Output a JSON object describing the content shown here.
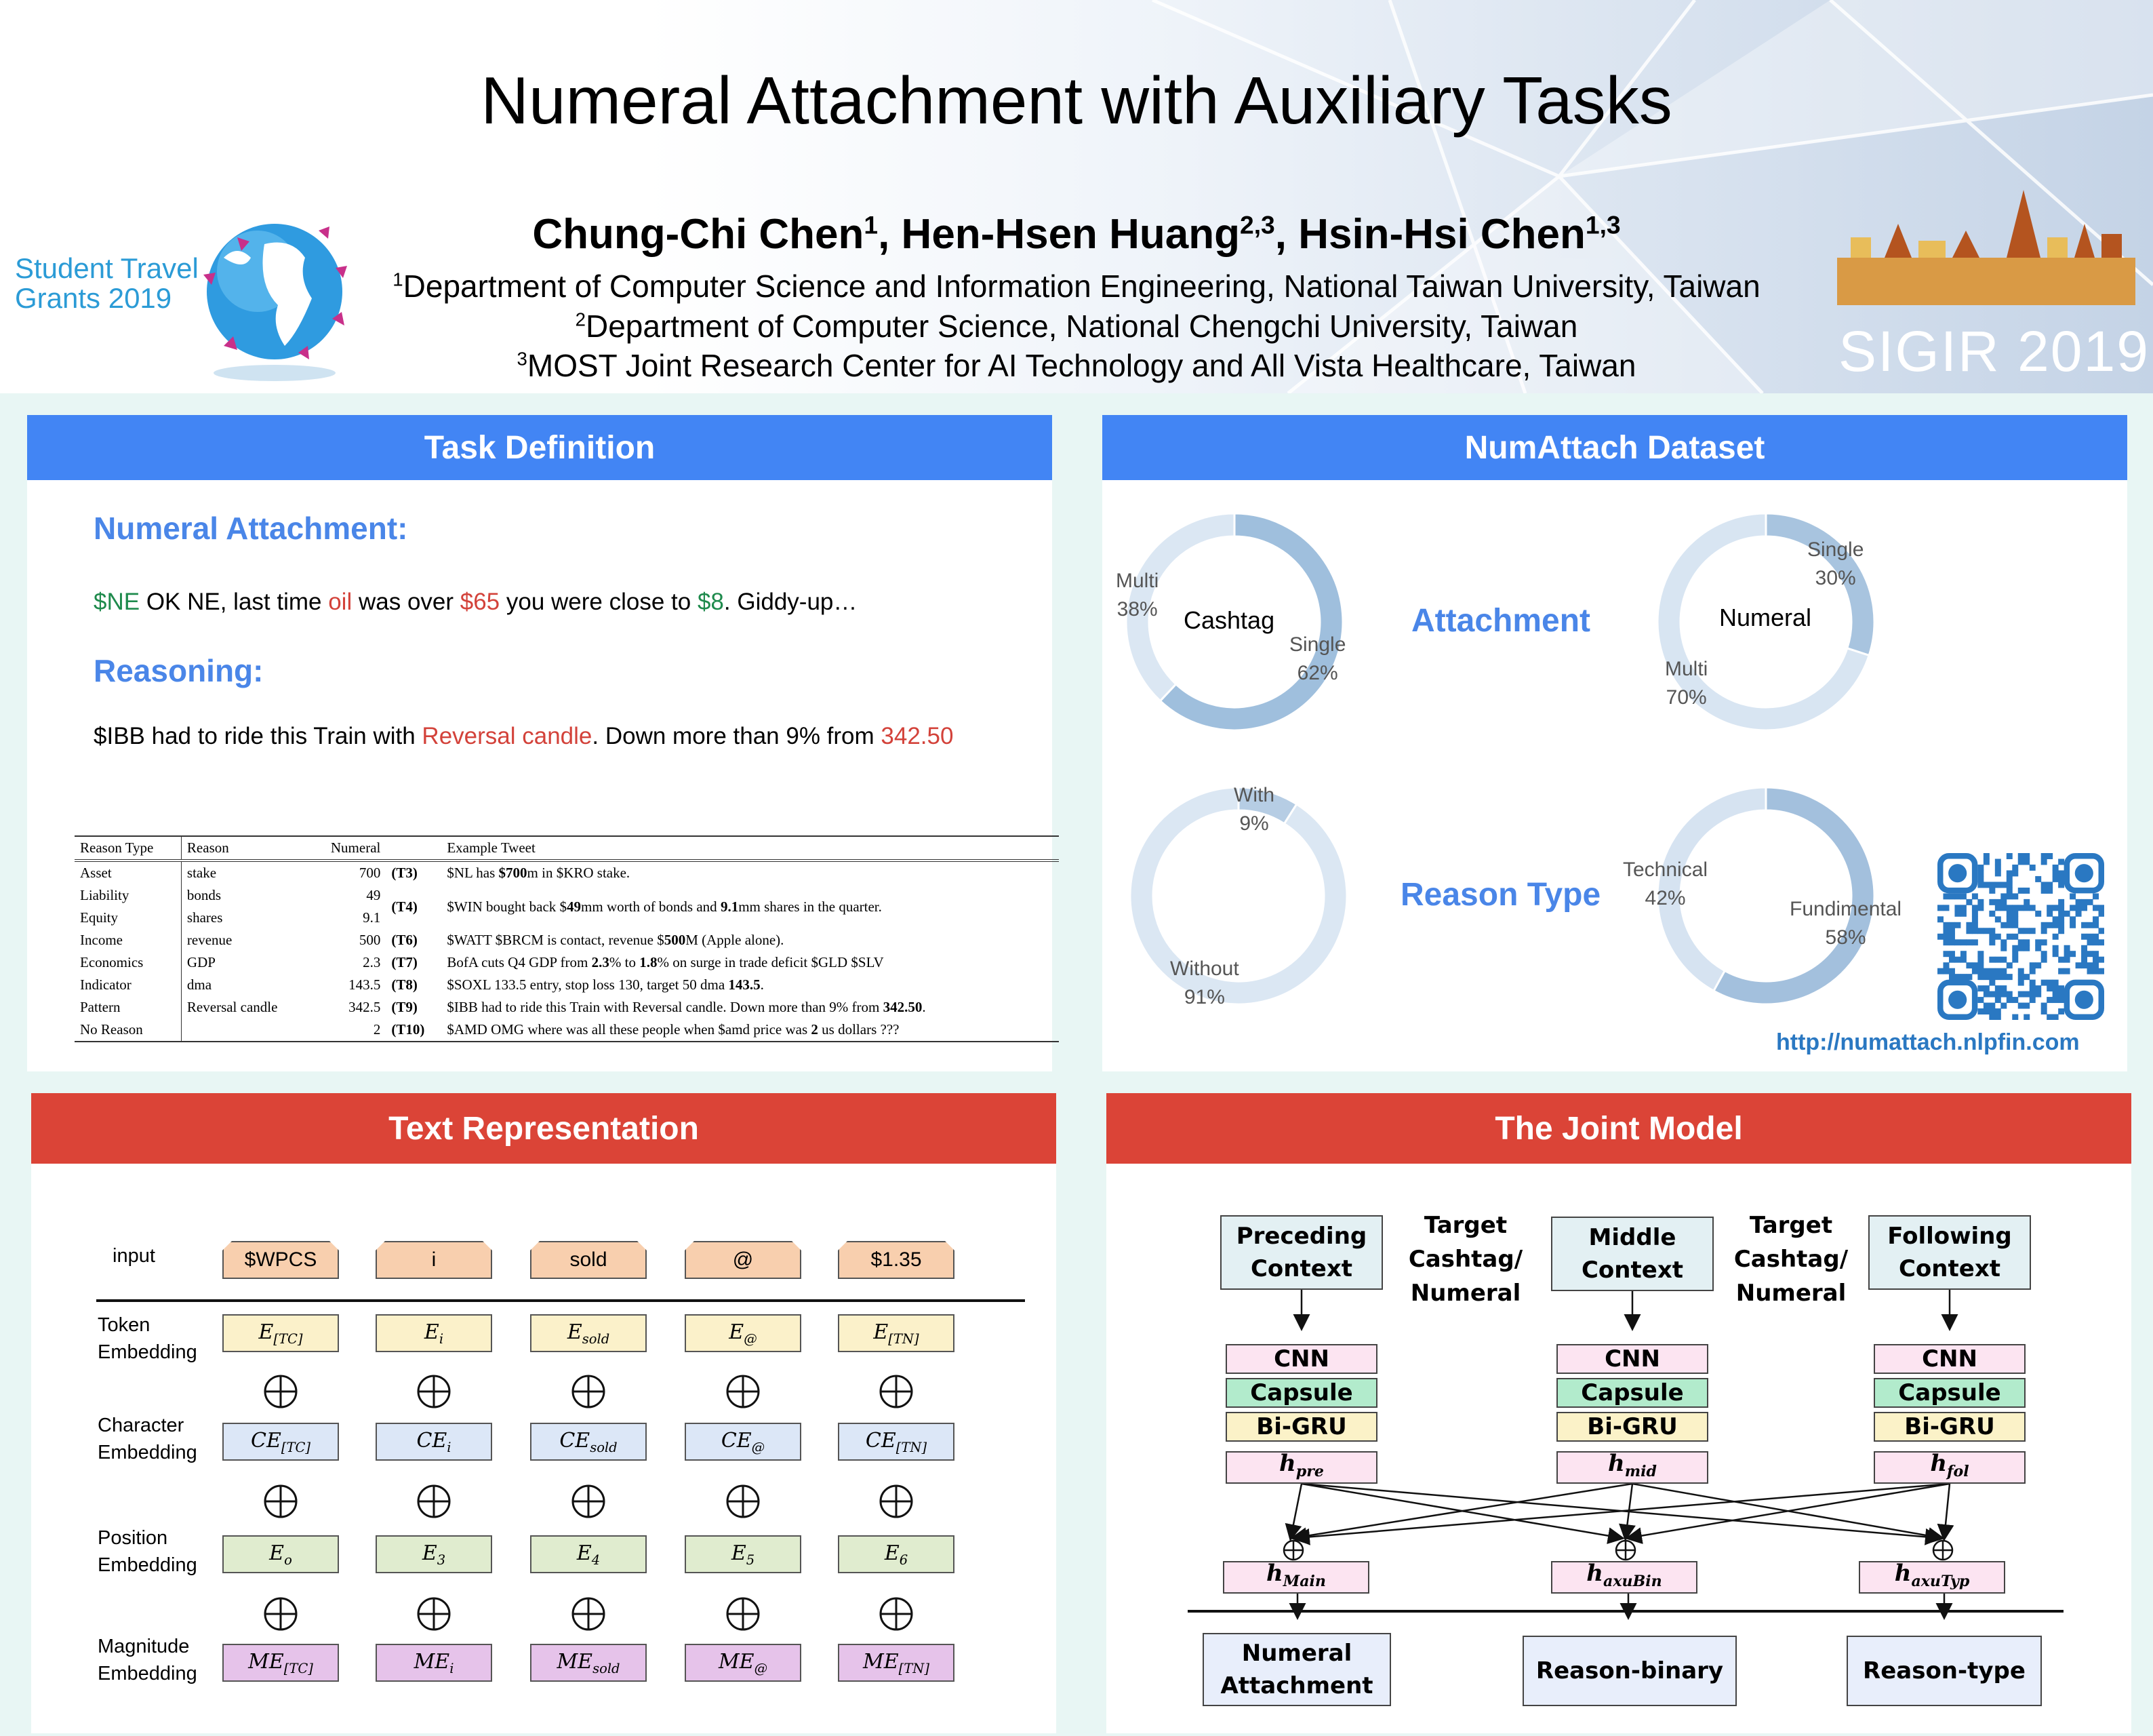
{
  "header": {
    "title": "Numeral Attachment with Auxiliary Tasks",
    "authors": [
      {
        "name": "Chung-Chi Chen",
        "sup": "1"
      },
      {
        "name": "Hen-Hsen Huang",
        "sup": "2,3"
      },
      {
        "name": "Hsin-Hsi Chen",
        "sup": "1,3"
      }
    ],
    "affiliations": [
      {
        "sup": "1",
        "text": "Department of Computer Science and Information Engineering, National Taiwan University, Taiwan"
      },
      {
        "sup": "2",
        "text": "Department of Computer Science, National Chengchi University, Taiwan"
      },
      {
        "sup": "3",
        "text": "MOST Joint Research Center for AI Technology and All Vista Healthcare, Taiwan"
      }
    ],
    "logo_left": [
      "Student Travel",
      "Grants 2019"
    ],
    "logo_right": "SIGIR 2019"
  },
  "task_definition": {
    "heading": "Task Definition",
    "numeral_attachment_title": "Numeral Attachment:",
    "example1": [
      {
        "t": "$NE",
        "c": "green"
      },
      {
        "t": " OK NE, last time ",
        "c": "black"
      },
      {
        "t": "oil",
        "c": "red"
      },
      {
        "t": " was over ",
        "c": "black"
      },
      {
        "t": "$65",
        "c": "red"
      },
      {
        "t": " you were close to ",
        "c": "black"
      },
      {
        "t": "$8",
        "c": "green"
      },
      {
        "t": ". Giddy-up…",
        "c": "black"
      }
    ],
    "reasoning_title": "Reasoning:",
    "example2": [
      {
        "t": "$IBB had to ride this Train with ",
        "c": "black"
      },
      {
        "t": "Reversal candle",
        "c": "red"
      },
      {
        "t": ". Down more than 9% from ",
        "c": "black"
      },
      {
        "t": "342.50",
        "c": "red"
      }
    ],
    "table": {
      "headers": [
        "Reason Type",
        "Reason",
        "Numeral",
        "",
        "Example Tweet"
      ],
      "rows": [
        [
          "Asset",
          "stake",
          "700",
          "(T3)",
          "$NL has <b>$700</b>m in $KRO stake."
        ],
        [
          "Liability",
          "bonds",
          "49",
          "",
          ""
        ],
        [
          "Equity",
          "shares",
          "9.1",
          "(T4)",
          "$WIN bought back $<b>49</b>mm worth of bonds and <b>9.1</b>mm shares in the quarter."
        ],
        [
          "Income",
          "revenue",
          "500",
          "(T6)",
          "$WATT $BRCM is contact, revenue $<b>500</b>M (Apple alone)."
        ],
        [
          "Economics",
          "GDP",
          "2.3",
          "(T7)",
          "BofA cuts Q4 GDP from <b>2.3</b>% to <b>1.8</b>% on surge in trade deficit $GLD $SLV"
        ],
        [
          "Indicator",
          "dma",
          "143.5",
          "(T8)",
          "$SOXL 133.5 entry, stop loss 130, target 50 dma <b>143.5</b>."
        ],
        [
          "Pattern",
          "Reversal candle",
          "342.5",
          "(T9)",
          "$IBB had to ride this Train with Reversal candle. Down more than 9% from <b>342.50</b>."
        ],
        [
          "No Reason",
          "",
          "2",
          "(T10)",
          "$AMD OMG where was all these people when $amd price was <b>2</b> us dollars ???"
        ]
      ]
    }
  },
  "dataset": {
    "heading": "NumAttach Dataset",
    "attachment_label": "Attachment",
    "reason_label": "Reason Type",
    "url": "http://numattach.nlpfin.com",
    "cashtag": {
      "center": "Cashtag",
      "a_name": "Multi",
      "a_pct": "38%",
      "b_name": "Single",
      "b_pct": "62%"
    },
    "numeral": {
      "center": "Numeral",
      "a_name": "Single",
      "a_pct": "30%",
      "b_name": "Multi",
      "b_pct": "70%"
    },
    "with_reason": {
      "a_name": "With",
      "a_pct": "9%",
      "b_name": "Without",
      "b_pct": "91%"
    },
    "reason_type": {
      "a_name": "Technical",
      "a_pct": "42%",
      "b_name": "Fundimental",
      "b_pct": "58%"
    }
  },
  "chart_data": [
    {
      "type": "pie",
      "center_label": "Cashtag",
      "categories": [
        "Single",
        "Multi"
      ],
      "values": [
        62,
        38
      ]
    },
    {
      "type": "pie",
      "center_label": "Numeral",
      "categories": [
        "Single",
        "Multi"
      ],
      "values": [
        30,
        70
      ]
    },
    {
      "type": "pie",
      "categories": [
        "With",
        "Without"
      ],
      "values": [
        9,
        91
      ]
    },
    {
      "type": "pie",
      "categories": [
        "Fundimental",
        "Technical"
      ],
      "values": [
        58,
        42
      ]
    }
  ],
  "text_rep": {
    "heading": "Text Representation",
    "input_label": "input",
    "tokens": [
      "$WPCS",
      "i",
      "sold",
      "@",
      "$1.35"
    ],
    "row_labels": [
      [
        "Token",
        "Embedding"
      ],
      [
        "Character",
        "Embedding"
      ],
      [
        "Position",
        "Embedding"
      ],
      [
        "Magnitude",
        "Embedding"
      ]
    ],
    "token_emb": [
      [
        "E",
        "[TC]"
      ],
      [
        "E",
        "i"
      ],
      [
        "E",
        "sold"
      ],
      [
        "E",
        "@"
      ],
      [
        "E",
        "[TN]"
      ]
    ],
    "char_emb": [
      [
        "CE",
        "[TC]"
      ],
      [
        "CE",
        "i"
      ],
      [
        "CE",
        "sold"
      ],
      [
        "CE",
        "@"
      ],
      [
        "CE",
        "[TN]"
      ]
    ],
    "pos_emb": [
      [
        "E",
        "o"
      ],
      [
        "E",
        "3"
      ],
      [
        "E",
        "4"
      ],
      [
        "E",
        "5"
      ],
      [
        "E",
        "6"
      ]
    ],
    "mag_emb": [
      [
        "ME",
        "[TC]"
      ],
      [
        "ME",
        "i"
      ],
      [
        "ME",
        "sold"
      ],
      [
        "ME",
        "@"
      ],
      [
        "ME",
        "[TN]"
      ]
    ]
  },
  "joint_model": {
    "heading": "The Joint Model",
    "contexts": [
      [
        "Preceding",
        "Context"
      ],
      [
        "Middle",
        "Context"
      ],
      [
        "Following",
        "Context"
      ]
    ],
    "targets": [
      [
        "Target",
        "Cashtag/",
        "Numeral"
      ],
      [
        "Target",
        "Cashtag/",
        "Numeral"
      ]
    ],
    "layers": [
      "CNN",
      "Capsule",
      "Bi-GRU"
    ],
    "hidden": [
      [
        "h",
        "pre"
      ],
      [
        "h",
        "mid"
      ],
      [
        "h",
        "fol"
      ]
    ],
    "heads": [
      [
        "h",
        "Main"
      ],
      [
        "h",
        "axuBin"
      ],
      [
        "h",
        "axuTyp"
      ]
    ],
    "outputs": [
      [
        "Numeral",
        "Attachment"
      ],
      [
        "Reason-binary"
      ],
      [
        "Reason-type"
      ]
    ]
  }
}
